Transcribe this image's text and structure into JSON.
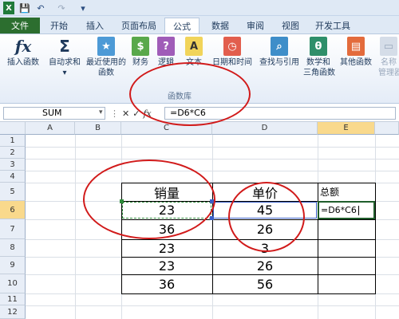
{
  "titlebar": {
    "icons": [
      "excel-icon",
      "save-icon",
      "undo-icon",
      "redo-icon",
      "customize-icon"
    ]
  },
  "tabs": [
    {
      "label": "文件",
      "active": false
    },
    {
      "label": "开始",
      "active": false
    },
    {
      "label": "插入",
      "active": false
    },
    {
      "label": "页面布局",
      "active": false
    },
    {
      "label": "公式",
      "active": true
    },
    {
      "label": "数据",
      "active": false
    },
    {
      "label": "审阅",
      "active": false
    },
    {
      "label": "视图",
      "active": false
    },
    {
      "label": "开发工具",
      "active": false
    }
  ],
  "ribbon": {
    "insert_function": {
      "label": "插入函数",
      "icon": "fx"
    },
    "autosum": {
      "label": "自动求和",
      "icon": "Σ"
    },
    "recent": {
      "label": "最近使用的",
      "label2": "函数"
    },
    "finance": {
      "label": "财务"
    },
    "logic": {
      "label": "逻辑"
    },
    "text": {
      "label": "文本",
      "icon": "A"
    },
    "datetime": {
      "label": "日期和时间"
    },
    "lookup": {
      "label": "查找与引用"
    },
    "math": {
      "label": "数学和",
      "label2": "三角函数",
      "icon": "θ"
    },
    "more": {
      "label": "其他函数"
    },
    "name_mgr": {
      "label": "名称",
      "label2": "管理器"
    },
    "group_label": "函数库"
  },
  "formula_bar": {
    "name_box": "SUM",
    "cancel": "✕",
    "enter": "✓",
    "fx": "fx",
    "formula": "=D6*C6"
  },
  "columns": [
    "A",
    "B",
    "C",
    "D",
    "E"
  ],
  "rows": [
    "1",
    "2",
    "3",
    "4",
    "5",
    "6",
    "7",
    "8",
    "9",
    "10",
    "11",
    "12"
  ],
  "table": {
    "header": {
      "c": "销量",
      "d": "单价",
      "e": "总额"
    },
    "rows": [
      {
        "c": "23",
        "d": "45"
      },
      {
        "c": "36",
        "d": "26"
      },
      {
        "c": "23",
        "d": "3"
      },
      {
        "c": "23",
        "d": "26"
      },
      {
        "c": "36",
        "d": "56"
      }
    ]
  },
  "editing_cell": "=D6*C6",
  "colors": {
    "accent_red": "#d11a1a",
    "file_tab": "#2c6e2f",
    "selected_header": "#f9d98c"
  }
}
